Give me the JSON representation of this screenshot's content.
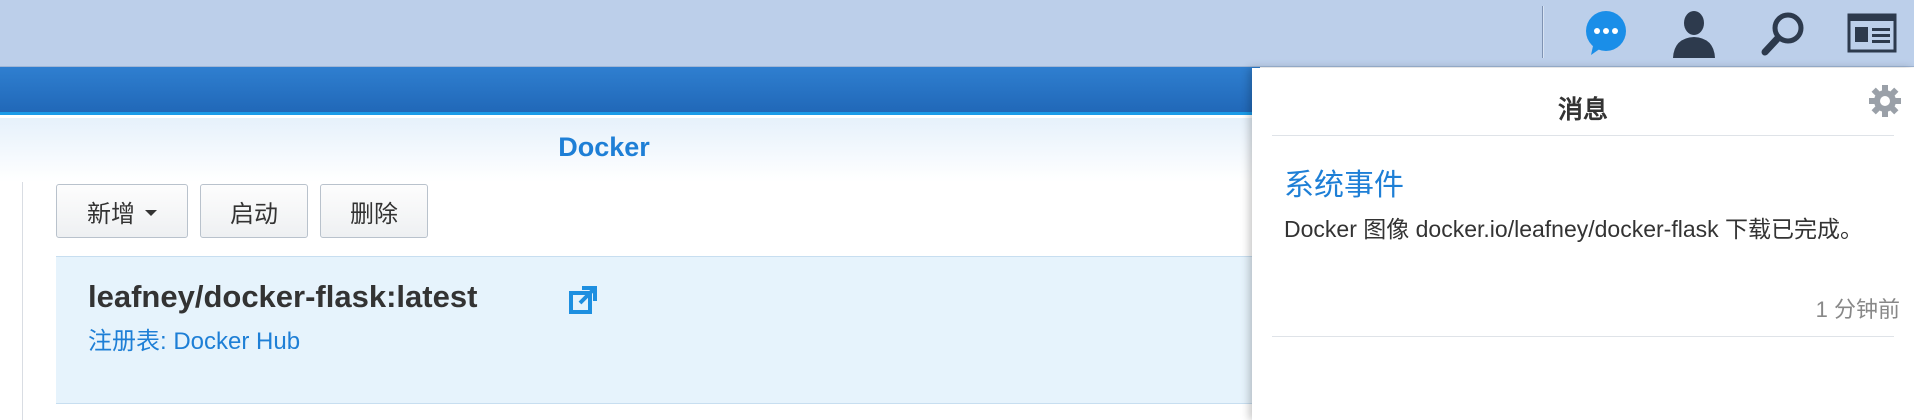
{
  "taskbar": {
    "icons": [
      "chat-icon",
      "user-icon",
      "search-icon",
      "id-card-icon"
    ],
    "accent": "#1e7fd6"
  },
  "window": {
    "title": "Docker"
  },
  "toolbar": {
    "new_label": "新增",
    "start_label": "启动",
    "delete_label": "删除"
  },
  "image": {
    "name": "leafney/docker-flask:latest",
    "registry": "注册表: Docker Hub"
  },
  "notifications": {
    "title": "消息",
    "event": {
      "title": "系统事件",
      "message": "Docker 图像 docker.io/leafney/docker-flask 下载已完成。",
      "time": "1 分钟前"
    }
  }
}
